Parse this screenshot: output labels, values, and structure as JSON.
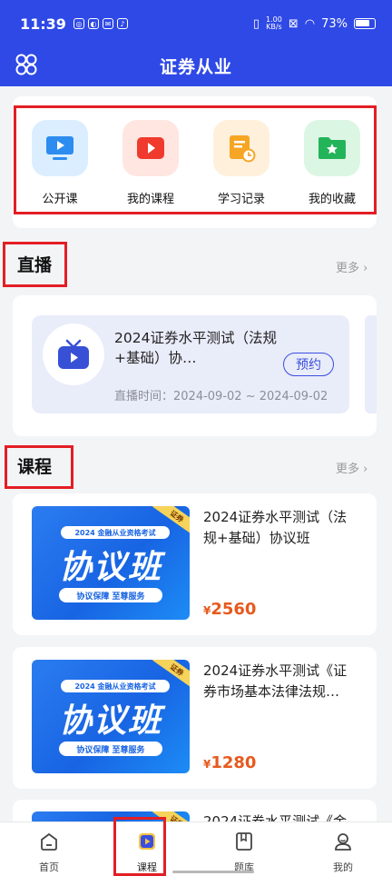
{
  "status_bar": {
    "time": "11:39",
    "speed": "1.00",
    "speed_unit": "KB/s",
    "battery": "73%"
  },
  "header": {
    "title": "证券从业"
  },
  "quick_menu": [
    {
      "label": "公开课",
      "icon": "video-screen-icon",
      "color": "#dbeeff"
    },
    {
      "label": "我的课程",
      "icon": "play-button-icon",
      "color": "#ffe6e0"
    },
    {
      "label": "学习记录",
      "icon": "clock-note-icon",
      "color": "#fff0dc"
    },
    {
      "label": "我的收藏",
      "icon": "star-folder-icon",
      "color": "#dcf6e4"
    }
  ],
  "live": {
    "section_title": "直播",
    "more": "更多",
    "item": {
      "title": "2024证券水平测试（法规+基础）协…",
      "button": "预约",
      "time": "直播时间：2024-09-02 ~ 2024-09-02"
    }
  },
  "courses": {
    "section_title": "课程",
    "more": "更多",
    "thumb": {
      "badge": "2024 金融从业资格考试",
      "headline": "协议班",
      "tagline": "协议保障 至尊服务",
      "corner": "证券"
    },
    "items": [
      {
        "title": "2024证券水平测试（法规+基础）协议班",
        "currency": "¥",
        "price": "2560"
      },
      {
        "title": "2024证券水平测试《证券市场基本法律法规…",
        "currency": "¥",
        "price": "1280"
      },
      {
        "title": "2024证券水平测试《金",
        "currency": "",
        "price": ""
      }
    ]
  },
  "tabbar": [
    {
      "label": "首页",
      "icon": "home-icon"
    },
    {
      "label": "课程",
      "icon": "course-play-icon"
    },
    {
      "label": "题库",
      "icon": "book-icon"
    },
    {
      "label": "我的",
      "icon": "user-icon"
    }
  ],
  "colors": {
    "primary": "#2f49e6",
    "price": "#e65a1e",
    "highlight": "#e31e24"
  }
}
